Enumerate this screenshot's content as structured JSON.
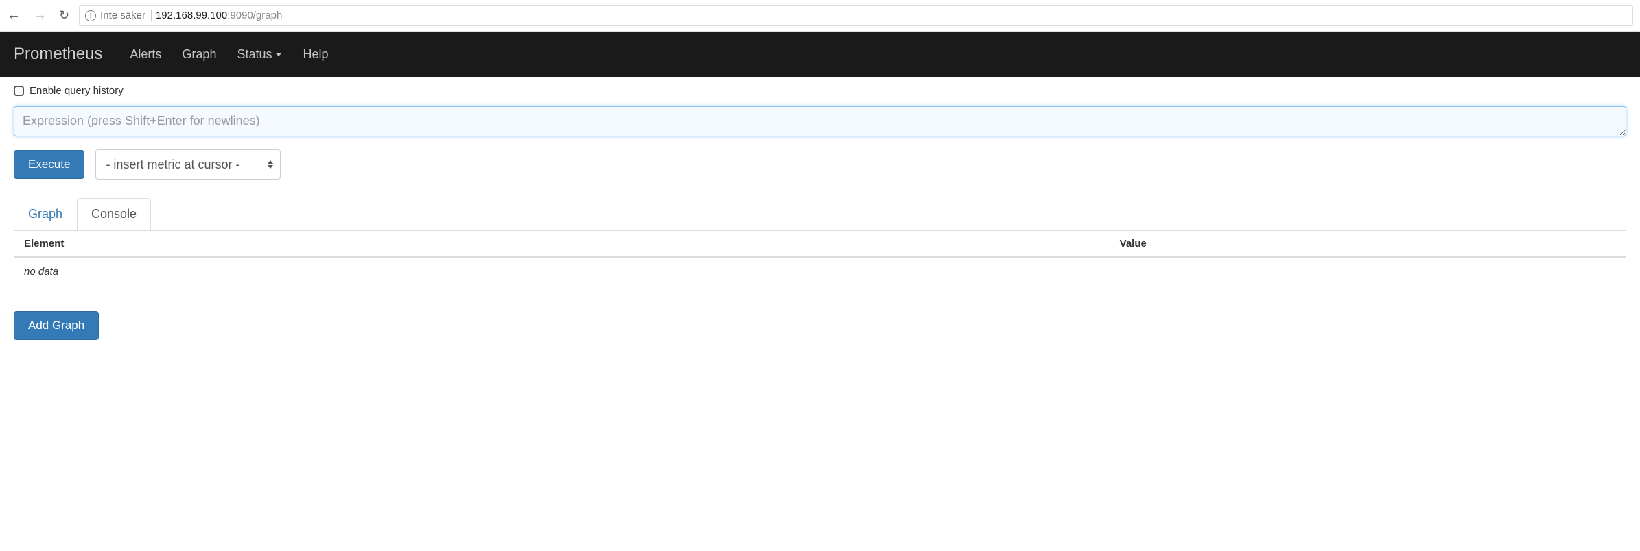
{
  "browser": {
    "security_text": "Inte säker",
    "url_host": "192.168.99.100",
    "url_port_path": ":9090/graph"
  },
  "navbar": {
    "brand": "Prometheus",
    "links": {
      "alerts": "Alerts",
      "graph": "Graph",
      "status": "Status",
      "help": "Help"
    }
  },
  "query_history_label": "Enable query history",
  "expression": {
    "placeholder": "Expression (press Shift+Enter for newlines)",
    "value": ""
  },
  "buttons": {
    "execute": "Execute",
    "add_graph": "Add Graph"
  },
  "metric_select": {
    "selected": "- insert metric at cursor -"
  },
  "tabs": {
    "graph": "Graph",
    "console": "Console"
  },
  "table": {
    "headers": {
      "element": "Element",
      "value": "Value"
    },
    "empty": "no data"
  }
}
